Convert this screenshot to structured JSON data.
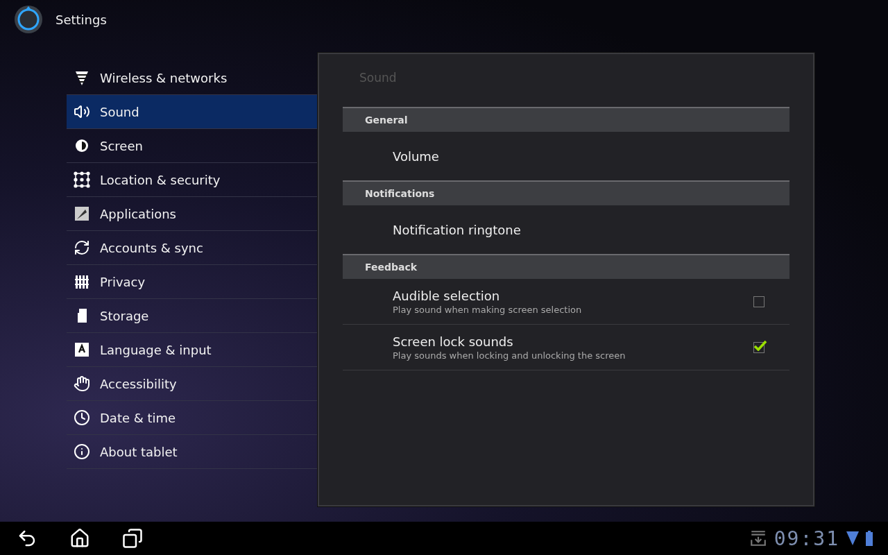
{
  "app_bar": {
    "title": "Settings"
  },
  "sidebar": {
    "items": [
      {
        "label": "Wireless & networks",
        "selected": false
      },
      {
        "label": "Sound",
        "selected": true
      },
      {
        "label": "Screen",
        "selected": false
      },
      {
        "label": "Location & security",
        "selected": false
      },
      {
        "label": "Applications",
        "selected": false
      },
      {
        "label": "Accounts & sync",
        "selected": false
      },
      {
        "label": "Privacy",
        "selected": false
      },
      {
        "label": "Storage",
        "selected": false
      },
      {
        "label": "Language & input",
        "selected": false
      },
      {
        "label": "Accessibility",
        "selected": false
      },
      {
        "label": "Date & time",
        "selected": false
      },
      {
        "label": "About tablet",
        "selected": false
      }
    ]
  },
  "panel": {
    "title": "Sound",
    "sections": [
      {
        "header": "General",
        "items": [
          {
            "kind": "plain",
            "title": "Volume"
          }
        ]
      },
      {
        "header": "Notifications",
        "items": [
          {
            "kind": "plain",
            "title": "Notification ringtone"
          }
        ]
      },
      {
        "header": "Feedback",
        "items": [
          {
            "kind": "checkbox",
            "title": "Audible selection",
            "summary": "Play sound when making screen selection",
            "checked": false
          },
          {
            "kind": "checkbox",
            "title": "Screen lock sounds",
            "summary": "Play sounds when locking and unlocking the screen",
            "checked": true
          }
        ]
      }
    ]
  },
  "status_bar": {
    "time": "09:31"
  }
}
